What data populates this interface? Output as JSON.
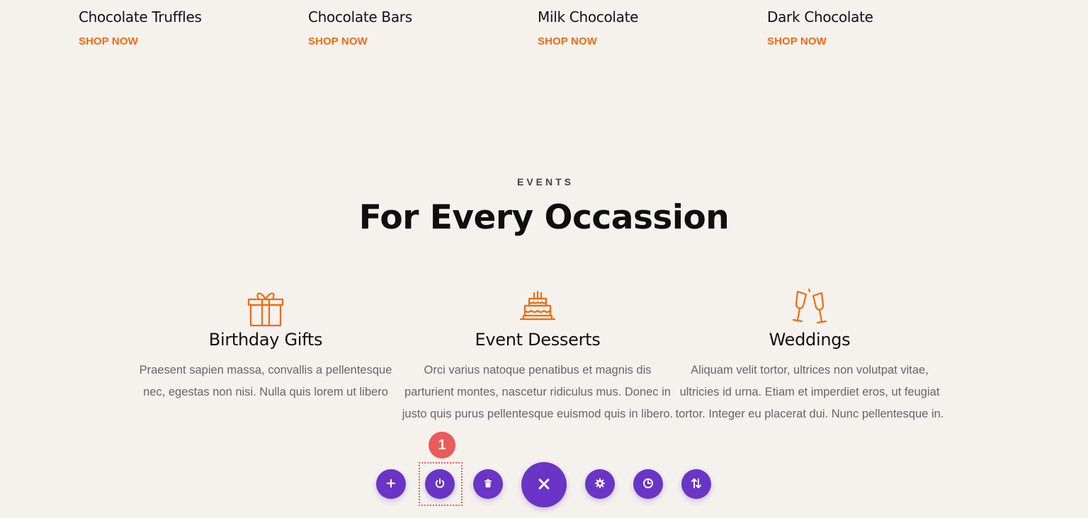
{
  "products": [
    {
      "name": "Chocolate Truffles",
      "cta": "SHOP NOW"
    },
    {
      "name": "Chocolate Bars",
      "cta": "SHOP NOW"
    },
    {
      "name": "Milk Chocolate",
      "cta": "SHOP NOW"
    },
    {
      "name": "Dark Chocolate",
      "cta": "SHOP NOW"
    }
  ],
  "events": {
    "eyebrow": "EVENTS",
    "title": "For Every Occassion",
    "items": [
      {
        "icon": "gift-icon",
        "title": "Birthday Gifts",
        "desc": "Praesent sapien massa, convallis a pellentesque nec, egestas non nisi. Nulla quis lorem ut libero"
      },
      {
        "icon": "cake-icon",
        "title": "Event Desserts",
        "desc": "Orci varius natoque penatibus et magnis dis parturient montes, nascetur ridiculus mus. Donec in justo quis purus pellentesque euismod quis in libero."
      },
      {
        "icon": "champagne-glasses-icon",
        "title": "Weddings",
        "desc": "Aliquam velit tortor, ultrices non volutpat vitae, ultricies id urna. Etiam et imperdiet eros, ut feugiat tortor. Integer eu placerat dui. Nunc pellentesque in."
      }
    ]
  },
  "toolbar": {
    "step_badge": "1",
    "buttons": [
      {
        "name": "add-button",
        "icon": "plus-icon"
      },
      {
        "name": "power-button",
        "icon": "power-icon"
      },
      {
        "name": "delete-button",
        "icon": "trash-icon"
      },
      {
        "name": "close-button",
        "icon": "close-icon"
      },
      {
        "name": "settings-button",
        "icon": "gear-icon"
      },
      {
        "name": "history-button",
        "icon": "clock-icon"
      },
      {
        "name": "sort-button",
        "icon": "sort-arrows-icon"
      }
    ]
  },
  "colors": {
    "background": "#f5f2ee",
    "accent": "#f26a10",
    "toolbar_purple": "#6a34c6",
    "badge_red": "#ec5a5a"
  }
}
